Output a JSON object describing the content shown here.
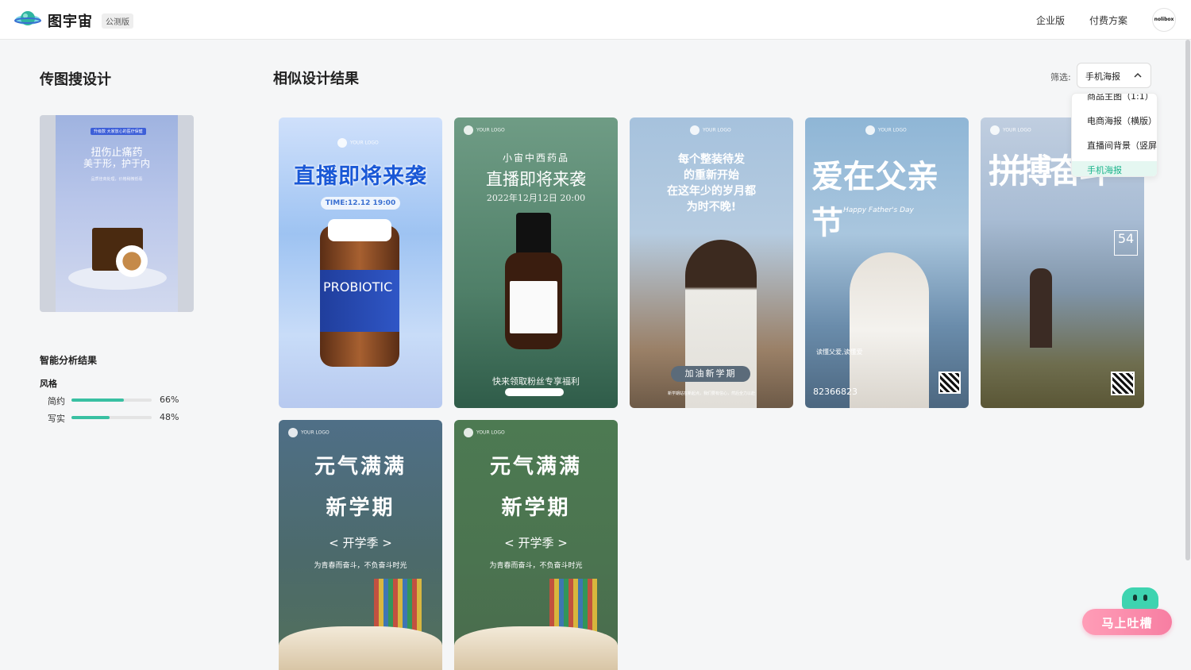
{
  "header": {
    "brand": "图宇宙",
    "badge": "公测版",
    "nav": [
      "企业版",
      "付费方案"
    ],
    "avatar_text": "nolibox"
  },
  "left": {
    "title": "传图搜设计",
    "upload_image": {
      "badge": "升级款 大家放心的医疗保健",
      "line1": "扭伤止痛药",
      "line2": "美于形，护于内",
      "small": "品质佳商处理，价格稍微低看"
    },
    "analysis_title": "智能分析结果",
    "style_title": "风格",
    "styles": [
      {
        "label": "简约",
        "percent": "66%",
        "value": 0.66
      },
      {
        "label": "写实",
        "percent": "48%",
        "value": 0.48
      }
    ]
  },
  "main": {
    "title": "相似设计结果",
    "filter": {
      "label": "筛选:",
      "selected": "手机海报",
      "options": [
        "商品主图（1:1）",
        "电商海报（横版）",
        "直播间背景（竖屏）",
        "手机海报"
      ]
    },
    "cards": [
      {
        "logo": "YOUR LOGO",
        "headline": "直播即将来袭",
        "time": "TIME:12.12 19:00",
        "label": "PROBIOTIC"
      },
      {
        "logo": "YOUR LOGO",
        "tag": "小宙中西药品",
        "headline": "直播即将来袭",
        "date": "2022年12月12日 20:00",
        "promo": "快来领取粉丝专享福利"
      },
      {
        "logo": "YOUR LOGO",
        "line1": "每个整装待发",
        "line2": "的重新开始",
        "line3": "在这年少的岁月都",
        "line4": "为时不晚!",
        "pill": "加油新学期",
        "foot": "新学期站在新起点，我们要有信心，然后全力以赴"
      },
      {
        "logo": "YOUR LOGO",
        "headline": "爱在父亲节",
        "sub": "Happy Father's Day",
        "small": "读懂父爱,读懂爱",
        "phone": "82366823"
      },
      {
        "logo": "YOUR LOGO",
        "headline": "拼搏奋斗",
        "number": "54"
      },
      {
        "logo": "YOUR LOGO",
        "line1": "元气满满",
        "line2": "新学期",
        "line3": "< 开学季 >",
        "line4": "为青春而奋斗，不负奋斗时光"
      },
      {
        "logo": "YOUR LOGO",
        "line1": "元气满满",
        "line2": "新学期",
        "line3": "< 开学季 >",
        "line4": "为青春而奋斗，不负奋斗时光"
      }
    ]
  },
  "feedback": {
    "label": "马上吐槽"
  },
  "colors": {
    "accent": "#39c0a2",
    "selected_bg": "#e5f7f1",
    "feedback": "#f77ea2"
  }
}
